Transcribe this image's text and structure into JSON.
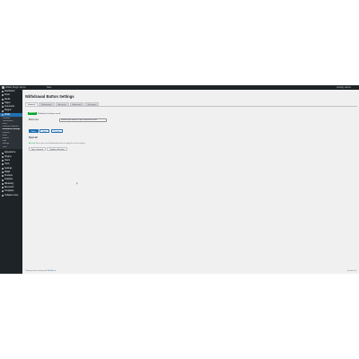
{
  "admin_bar": {
    "site_name": "Wallet Plugin Demo",
    "new_label": "New",
    "greeting": "Howdy, admin"
  },
  "sidebar": {
    "items_top": [
      {
        "label": "Dashboard"
      },
      {
        "label": "Posts"
      },
      {
        "label": "Media"
      },
      {
        "label": "Pages"
      },
      {
        "label": "Comments"
      },
      {
        "label": "Plugins"
      }
    ],
    "active_menu": "Wallet",
    "submenu": [
      {
        "label": "Overview"
      },
      {
        "label": "Transactions"
      },
      {
        "label": "Users"
      },
      {
        "label": "Withdraw Requests"
      },
      {
        "label": "Withdrawal Settings"
      },
      {
        "label": "Deposits"
      },
      {
        "label": "Rates"
      },
      {
        "label": "Reports"
      },
      {
        "label": "Logs"
      },
      {
        "label": "Settings"
      },
      {
        "label": "Tools"
      }
    ],
    "items_bottom": [
      {
        "label": "Appearance"
      },
      {
        "label": "Plugins"
      },
      {
        "label": "Users"
      },
      {
        "label": "Tools"
      },
      {
        "label": "Settings"
      },
      {
        "label": "Wallet"
      },
      {
        "label": "Products"
      },
      {
        "label": "Analytics"
      },
      {
        "label": "Marketing"
      },
      {
        "label": "Elementor"
      },
      {
        "label": "Templates"
      },
      {
        "label": "Collapse menu"
      }
    ]
  },
  "page": {
    "title": "Withdrawal Button Settings",
    "tabs": [
      {
        "label": "General",
        "active": true
      },
      {
        "label": "Withdrawals",
        "active": false
      },
      {
        "label": "Accounts",
        "active": false
      },
      {
        "label": "Advanced",
        "active": false
      },
      {
        "label": "Messages",
        "active": false
      }
    ],
    "notice": {
      "badge": "Updated",
      "text": "Withdrawal settings saved."
    },
    "field": {
      "label": "Button text",
      "value": "Withdraw your balance to your connected account"
    },
    "buttons": {
      "primary": "Save",
      "secondary_1": "Reset",
      "secondary_2": "Preview"
    },
    "section": {
      "title": "Sync all",
      "help_tag": "All active",
      "help_text": "Run a sync on all withdrawal buttons to apply the current settings."
    },
    "actions": {
      "first": "Sync selected",
      "second": "Update all buttons"
    }
  },
  "footer": {
    "left_text": "Thank you for creating with",
    "left_link": "WordPress",
    "right_text": "Version 6.4"
  }
}
